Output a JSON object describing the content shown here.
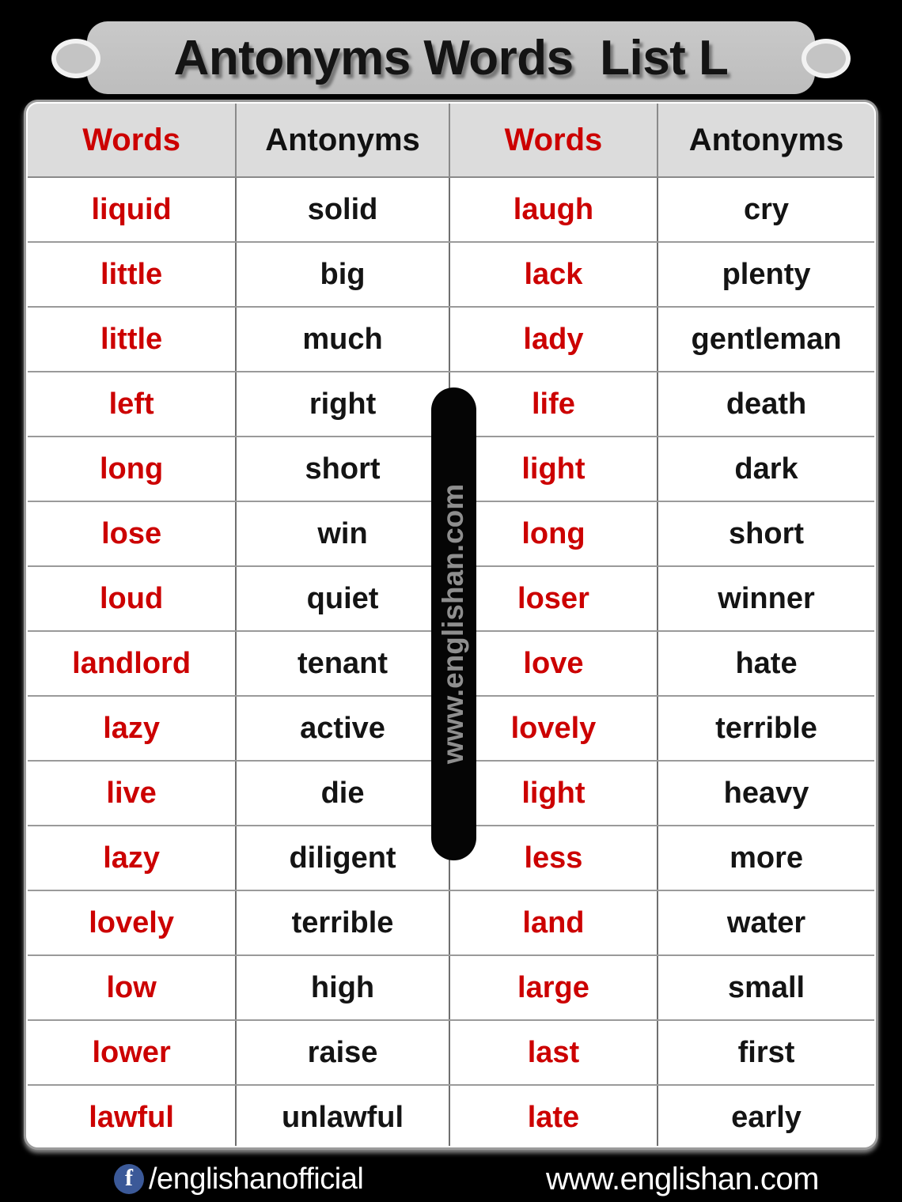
{
  "title": "Antonyms Words  List L",
  "table": {
    "headers": [
      "Words",
      "Antonyms",
      "Words",
      "Antonyms"
    ],
    "rows": [
      {
        "left_word": "liquid",
        "left_antonym": "solid",
        "right_word": "laugh",
        "right_antonym": "cry"
      },
      {
        "left_word": "little",
        "left_antonym": "big",
        "right_word": "lack",
        "right_antonym": "plenty"
      },
      {
        "left_word": "little",
        "left_antonym": "much",
        "right_word": "lady",
        "right_antonym": "gentleman"
      },
      {
        "left_word": "left",
        "left_antonym": "right",
        "right_word": "life",
        "right_antonym": "death"
      },
      {
        "left_word": "long",
        "left_antonym": "short",
        "right_word": "light",
        "right_antonym": "dark"
      },
      {
        "left_word": "lose",
        "left_antonym": "win",
        "right_word": "long",
        "right_antonym": "short"
      },
      {
        "left_word": "loud",
        "left_antonym": "quiet",
        "right_word": "loser",
        "right_antonym": "winner"
      },
      {
        "left_word": "landlord",
        "left_antonym": "tenant",
        "right_word": "love",
        "right_antonym": "hate"
      },
      {
        "left_word": "lazy",
        "left_antonym": "active",
        "right_word": "lovely",
        "right_antonym": "terrible"
      },
      {
        "left_word": "live",
        "left_antonym": "die",
        "right_word": "light",
        "right_antonym": "heavy"
      },
      {
        "left_word": "lazy",
        "left_antonym": "diligent",
        "right_word": "less",
        "right_antonym": "more"
      },
      {
        "left_word": "lovely",
        "left_antonym": "terrible",
        "right_word": "land",
        "right_antonym": "water"
      },
      {
        "left_word": "low",
        "left_antonym": "high",
        "right_word": "large",
        "right_antonym": "small"
      },
      {
        "left_word": "lower",
        "left_antonym": "raise",
        "right_word": "last",
        "right_antonym": "first"
      },
      {
        "left_word": "lawful",
        "left_antonym": "unlawful",
        "right_word": "late",
        "right_antonym": "early"
      }
    ]
  },
  "watermark": {
    "text": "www.englishan.com"
  },
  "footer": {
    "facebook_icon": "facebook-icon",
    "facebook_glyph": "f",
    "facebook_handle": "/englishanofficial",
    "website": "www.englishan.com"
  },
  "colors": {
    "word_red": "#cc0000",
    "antonym_black": "#141414",
    "header_bg": "#dcdcdc",
    "banner_gray": "#c3c3c3",
    "page_bg": "#000000",
    "facebook_blue": "#3b5998"
  }
}
